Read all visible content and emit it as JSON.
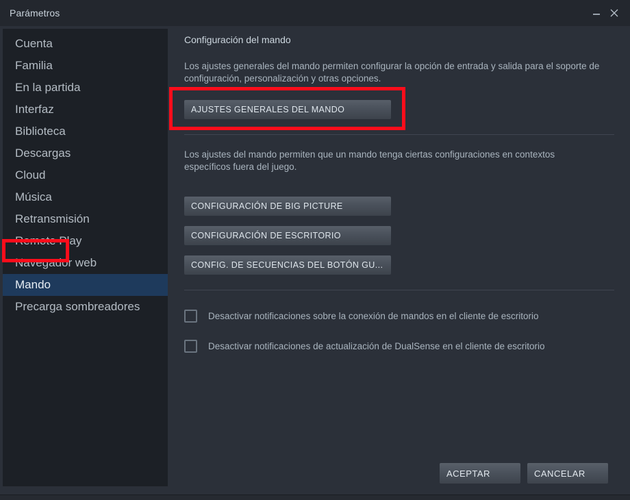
{
  "window": {
    "title": "Parámetros",
    "controls": {
      "minimize": "minimize-icon",
      "close": "close-icon"
    }
  },
  "sidebar": {
    "items": [
      {
        "label": "Cuenta",
        "selected": false
      },
      {
        "label": "Familia",
        "selected": false
      },
      {
        "label": "En la partida",
        "selected": false
      },
      {
        "label": "Interfaz",
        "selected": false
      },
      {
        "label": "Biblioteca",
        "selected": false
      },
      {
        "label": "Descargas",
        "selected": false
      },
      {
        "label": "Cloud",
        "selected": false
      },
      {
        "label": "Música",
        "selected": false
      },
      {
        "label": "Retransmisión",
        "selected": false
      },
      {
        "label": "Remote Play",
        "selected": false
      },
      {
        "label": "Navegador web",
        "selected": false
      },
      {
        "label": "Mando",
        "selected": true
      },
      {
        "label": "Precarga sombreadores",
        "selected": false
      }
    ]
  },
  "main": {
    "section_title": "Configuración del mando",
    "description_1": "Los ajustes generales del mando permiten configurar la opción de entrada y salida para el soporte de configuración, personalización y otras opciones.",
    "general_button": "AJUSTES GENERALES DEL MANDO",
    "description_2": "Los ajustes del mando permiten que un mando tenga ciertas configuraciones en contextos específicos fuera del juego.",
    "buttons": [
      "CONFIGURACIÓN DE BIG PICTURE",
      "CONFIGURACIÓN DE ESCRITORIO",
      "CONFIG. DE SECUENCIAS DEL BOTÓN GU..."
    ],
    "checkboxes": [
      {
        "label": "Desactivar notificaciones sobre la conexión de mandos en el cliente de escritorio",
        "checked": false
      },
      {
        "label": "Desactivar notificaciones de actualización de DualSense en el cliente de escritorio",
        "checked": false
      }
    ]
  },
  "footer": {
    "accept": "ACEPTAR",
    "cancel": "CANCELAR"
  },
  "annotations": {
    "highlight_color": "#fc0d1b",
    "boxes": [
      {
        "target": "sidebar-item-mando"
      },
      {
        "target": "general-controller-settings-button"
      }
    ]
  },
  "colors": {
    "window_background": "#2b3039",
    "sidebar_background": "#1c2026",
    "titlebar_background": "#23272e",
    "selection_blue": "#1e3a5c",
    "text_primary": "#c6d4df",
    "text_secondary": "#a9b4be"
  }
}
